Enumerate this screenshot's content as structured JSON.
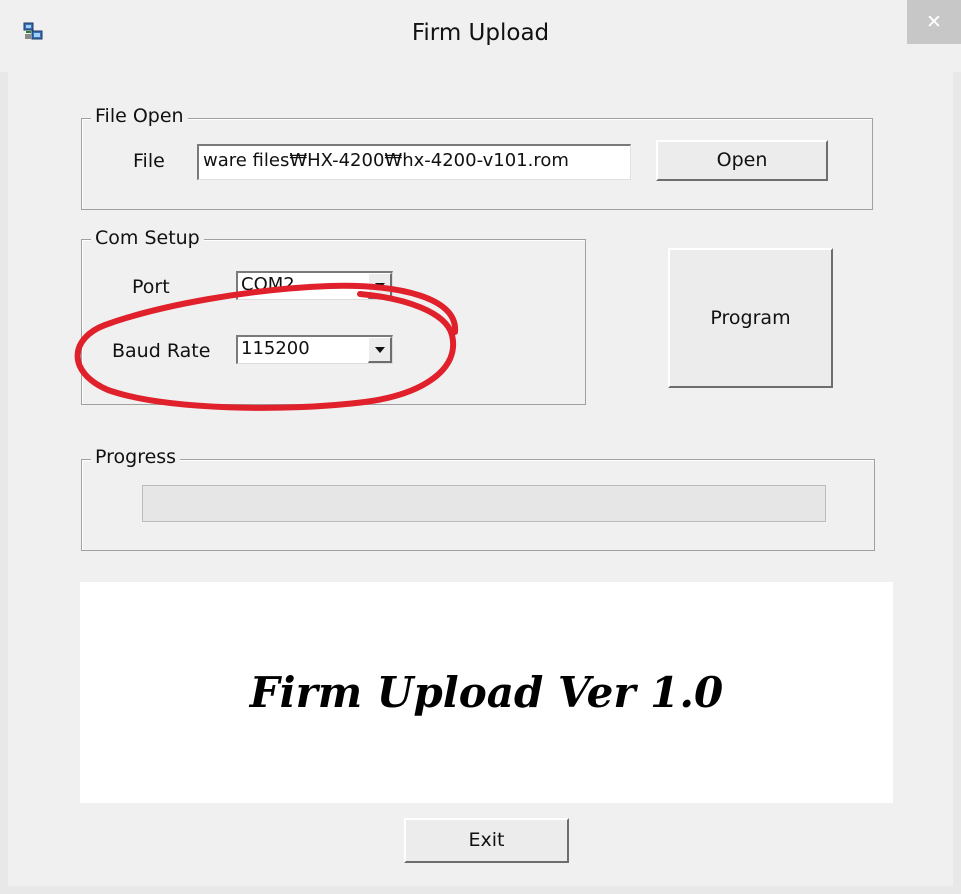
{
  "window": {
    "title": "Firm Upload",
    "close_glyph": "✕",
    "icon": "computer-network-icon"
  },
  "file_open": {
    "group_label": "File Open",
    "file_label": "File",
    "file_path": "ware files₩HX-4200₩hx-4200-v101.rom",
    "open_button": "Open"
  },
  "com_setup": {
    "group_label": "Com Setup",
    "port_label": "Port",
    "port_value": "COM2",
    "baud_label": "Baud Rate",
    "baud_value": "115200"
  },
  "program_button": "Program",
  "progress": {
    "group_label": "Progress",
    "value": 0
  },
  "banner": {
    "text": "Firm Upload Ver 1.0"
  },
  "exit_button": "Exit",
  "colors": {
    "annotation_ellipse": "#e0202a",
    "window_bg": "#f0f0f0",
    "close_button_bg": "#c7c7c7",
    "progress_fill": "#06b025"
  }
}
